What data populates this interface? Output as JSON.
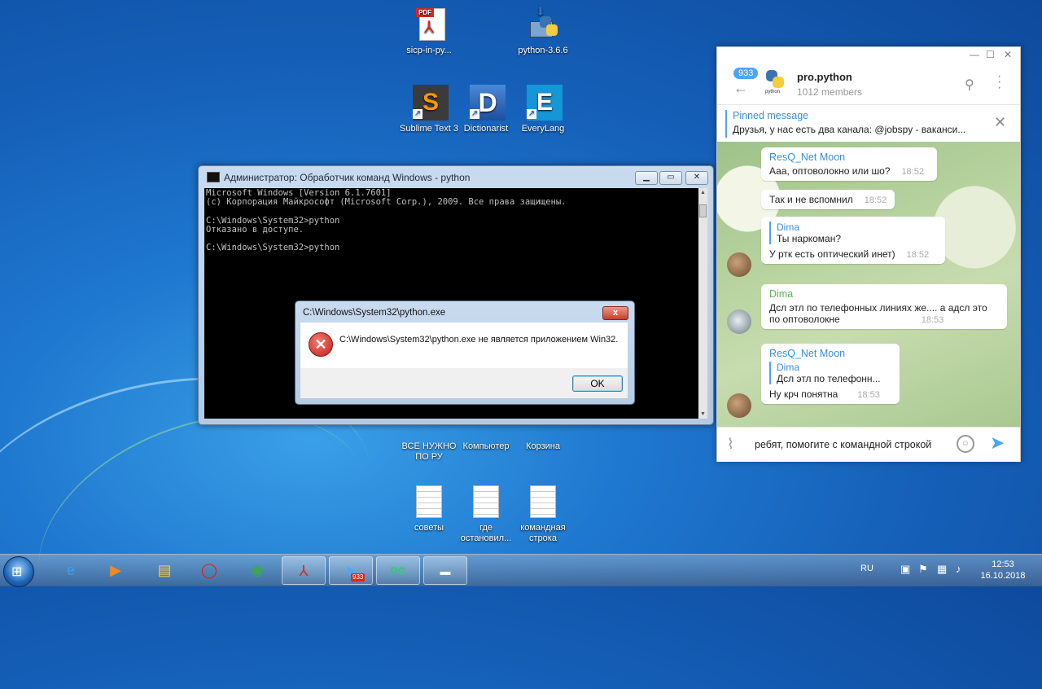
{
  "desktop": {
    "icons": [
      {
        "label": "sicp-in-py..."
      },
      {
        "label": "python-3.6.6"
      },
      {
        "label": "Sublime Text 3"
      },
      {
        "label": "Dictionarist"
      },
      {
        "label": "EveryLang"
      },
      {
        "label": "ВСЕ НУЖНО ПО РУ"
      },
      {
        "label": "Компьютер"
      },
      {
        "label": "Корзина"
      },
      {
        "label": "советы"
      },
      {
        "label": "где остановил..."
      },
      {
        "label": "командная строка"
      }
    ]
  },
  "cmd": {
    "title": "Администратор: Обработчик команд Windows - python",
    "console_text": "Microsoft Windows [Version 6.1.7601]\n(c) Корпорация Майкрософт (Microsoft Corp.), 2009. Все права защищены.\n\nC:\\Windows\\System32>python\nОтказано в доступе.\n\nC:\\Windows\\System32>python"
  },
  "error_dialog": {
    "title": "C:\\Windows\\System32\\python.exe",
    "message": "C:\\Windows\\System32\\python.exe не является приложением Win32.",
    "ok_label": "OK",
    "close_label": "x"
  },
  "telegram": {
    "unread_badge": "933",
    "group_name": "pro.python",
    "members": "1012 members",
    "pinned_title": "Pinned message",
    "pinned_text": "Друзья, у нас есть два канала: @jobspy - ваканси...",
    "messages": [
      {
        "name": "ResQ_Net Moon",
        "text": "Ааа, оптоволокно или шо?",
        "time": "18:52"
      },
      {
        "text": "Так и не вспомнил",
        "time": "18:52"
      },
      {
        "quote_name": "Dima",
        "quote_text": "Ты наркоман?",
        "text": "У ртк есть оптический инет)",
        "time": "18:52"
      },
      {
        "name": "Dima",
        "text": "Дсл этл по телефонных линиях же.... а адсл это",
        "text2": "по оптоволокне",
        "time": "18:53"
      },
      {
        "name": "ResQ_Net Moon",
        "quote_name": "Dima",
        "quote_text": "Дсл этл по телефонн...",
        "text": "Ну крч понятна",
        "time": "18:53"
      }
    ],
    "input_text": "ребят, помогите с командной строкой"
  },
  "taskbar": {
    "badge": "933",
    "lang": "RU",
    "time": "12:53",
    "date": "16.10.2018"
  }
}
